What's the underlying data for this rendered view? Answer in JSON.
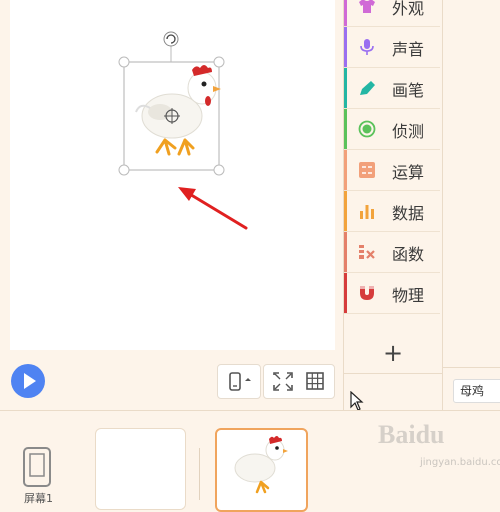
{
  "categories": [
    {
      "label": "外观",
      "color": "#d06ad6",
      "icon": "shirt-icon"
    },
    {
      "label": "声音",
      "color": "#9a6ff0",
      "icon": "microphone-icon"
    },
    {
      "label": "画笔",
      "color": "#23b6a4",
      "icon": "pen-icon"
    },
    {
      "label": "侦测",
      "color": "#5bc25b",
      "icon": "sensor-icon"
    },
    {
      "label": "运算",
      "color": "#f2a07a",
      "icon": "calculator-icon"
    },
    {
      "label": "数据",
      "color": "#f2a33c",
      "icon": "bar-chart-icon"
    },
    {
      "label": "函数",
      "color": "#e4806a",
      "icon": "function-icon"
    },
    {
      "label": "物理",
      "color": "#d63c3c",
      "icon": "magnet-icon"
    }
  ],
  "add_label": "+",
  "sprite": {
    "name": "母鸡"
  },
  "screen": {
    "label": "屏幕1"
  },
  "watermark": {
    "main": "Baidu",
    "sub": "jingyan.baidu.com"
  },
  "colors": {
    "accent": "#4f83f2",
    "arrow": "#e02020",
    "selected_border": "#f0a45d"
  }
}
